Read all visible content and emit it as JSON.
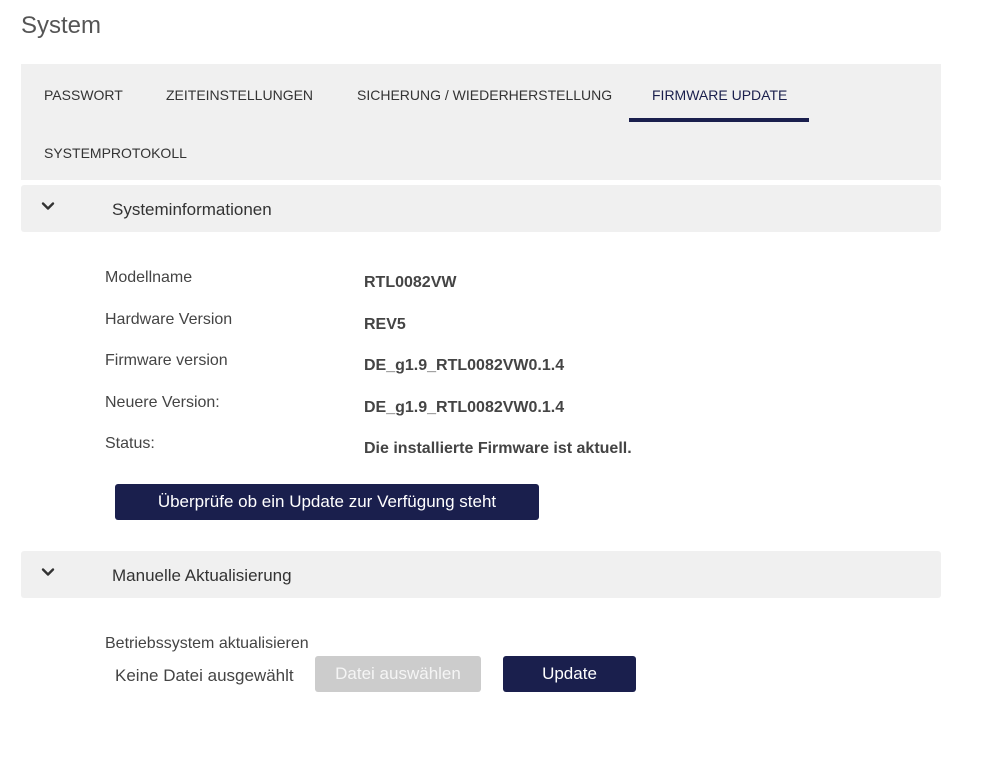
{
  "page": {
    "title": "System"
  },
  "tabs": [
    {
      "label": "PASSWORT",
      "active": false
    },
    {
      "label": "ZEITEINSTELLUNGEN",
      "active": false
    },
    {
      "label": "SICHERUNG / WIEDERHERSTELLUNG",
      "active": false
    },
    {
      "label": "FIRMWARE UPDATE",
      "active": true
    },
    {
      "label": "SYSTEMPROTOKOLL",
      "active": false
    }
  ],
  "system_info": {
    "header": "Systeminformationen",
    "rows": [
      {
        "label": "Modellname",
        "value": "RTL0082VW"
      },
      {
        "label": "Hardware Version",
        "value": "REV5"
      },
      {
        "label": "Firmware version",
        "value": "DE_g1.9_RTL0082VW0.1.4"
      },
      {
        "label": "Neuere Version:",
        "value": "DE_g1.9_RTL0082VW0.1.4"
      },
      {
        "label": "Status:",
        "value": "Die installierte Firmware ist aktuell."
      }
    ],
    "check_button": "Überprüfe ob ein Update zur Verfügung steht"
  },
  "manual_update": {
    "header": "Manuelle Aktualisierung",
    "label": "Betriebssystem aktualisieren",
    "file_status": "Keine Datei ausgewählt",
    "choose_file_button": "Datei auswählen",
    "update_button": "Update"
  },
  "icons": {
    "collapse": "chevron-down-icon"
  },
  "colors": {
    "accent": "#1a1f4d",
    "panel": "#f0f0f0",
    "disabled": "#cccccc"
  }
}
